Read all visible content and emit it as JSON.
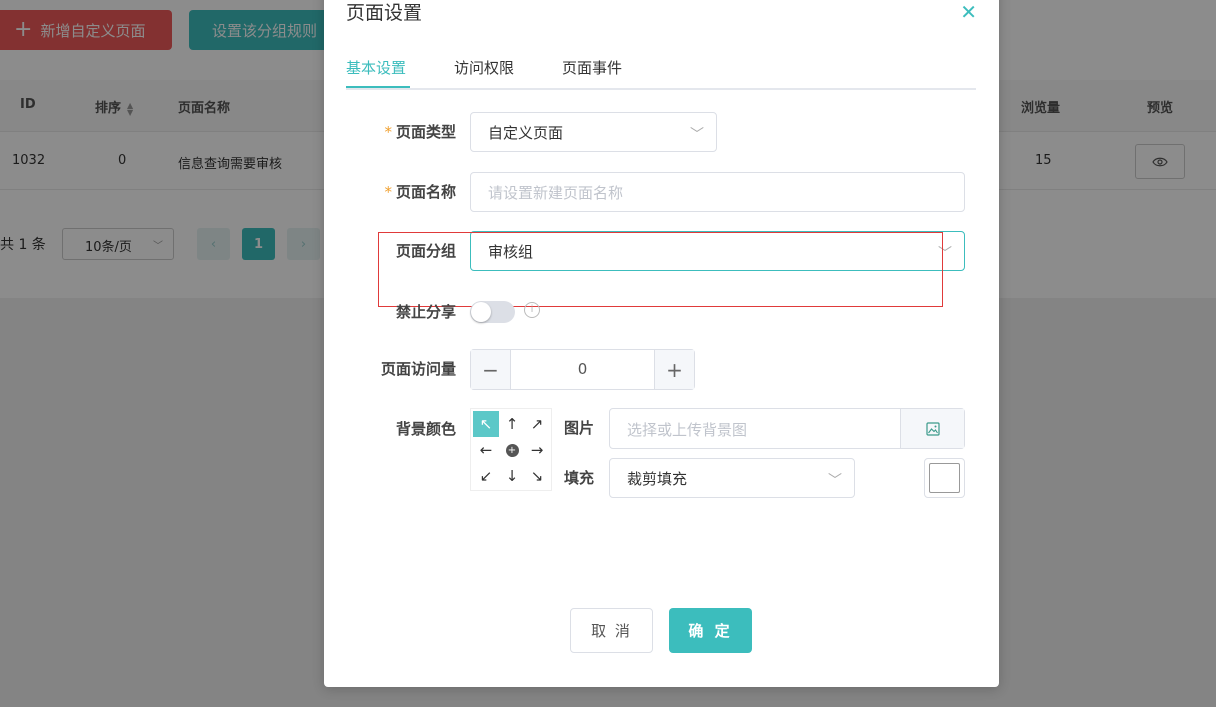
{
  "background": {
    "add_button": "新增自定义页面",
    "rule_button": "设置该分组规则",
    "table": {
      "headers": {
        "id": "ID",
        "sort": "排序",
        "name": "页面名称",
        "views": "浏览量",
        "preview": "预览"
      },
      "row": {
        "id": "1032",
        "sort": "0",
        "name": "信息查询需要审核",
        "views": "15"
      }
    },
    "pagination": {
      "total": "共 1 条",
      "page_size": "10条/页",
      "current": "1"
    }
  },
  "modal": {
    "title": "页面设置",
    "tabs": [
      "基本设置",
      "访问权限",
      "页面事件"
    ],
    "form": {
      "page_type": {
        "label": "页面类型",
        "value": "自定义页面"
      },
      "page_name": {
        "label": "页面名称",
        "placeholder": "请设置新建页面名称"
      },
      "page_group": {
        "label": "页面分组",
        "value": "审核组"
      },
      "disable_share": {
        "label": "禁止分享",
        "enabled": false
      },
      "page_views": {
        "label": "页面访问量",
        "value": "0"
      },
      "bg_color": {
        "label": "背景颜色"
      },
      "image": {
        "label": "图片",
        "placeholder": "选择或上传背景图"
      },
      "fill": {
        "label": "填充",
        "value": "裁剪填充"
      }
    },
    "cancel": "取 消",
    "confirm": "确 定"
  },
  "colors": {
    "accent": "#3cbdbd",
    "danger": "#ee5a5a",
    "highlight_box": "#e03a3a"
  }
}
